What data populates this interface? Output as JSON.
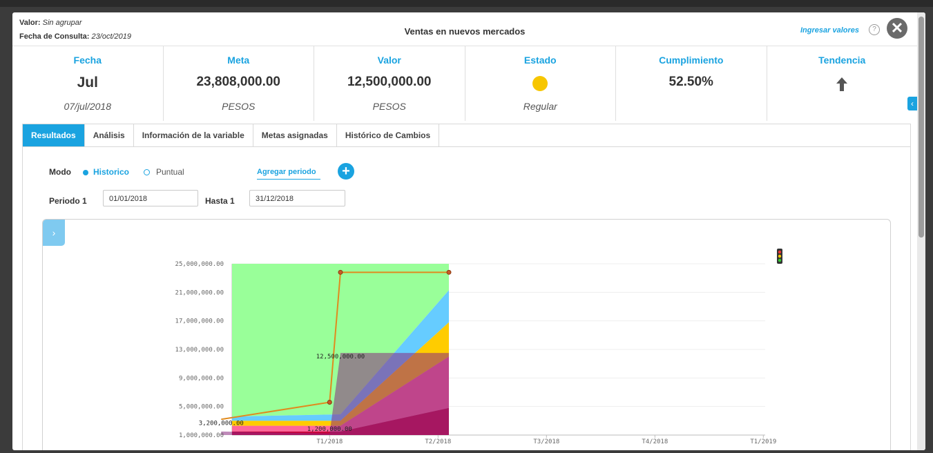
{
  "header": {
    "valor_label": "Valor:",
    "valor_value": "Sin agrupar",
    "fecha_label": "Fecha de Consulta:",
    "fecha_value": "23/oct/2019",
    "title": "Ventas en nuevos mercados",
    "ingresar": "Ingresar valores",
    "help": "?",
    "close": "✕"
  },
  "summary": [
    {
      "head": "Fecha",
      "value": "Jul",
      "sub": "07/jul/2018"
    },
    {
      "head": "Meta",
      "value": "23,808,000.00",
      "sub": "PESOS"
    },
    {
      "head": "Valor",
      "value": "12,500,000.00",
      "sub": "PESOS"
    },
    {
      "head": "Estado",
      "value": "",
      "sub": "Regular"
    },
    {
      "head": "Cumplimiento",
      "value": "52.50%",
      "sub": ""
    },
    {
      "head": "Tendencia",
      "value": "",
      "sub": ""
    }
  ],
  "status_color": "#f7c600",
  "tendencia_icon": "arrow-up-icon",
  "tabs": [
    "Resultados",
    "Análisis",
    "Información de la variable",
    "Metas asignadas",
    "Histórico de Cambios"
  ],
  "controls": {
    "modo": "Modo",
    "historico": "Historico",
    "puntual": "Puntual",
    "agregar": "Agregar periodo",
    "periodo_label": "Periodo 1",
    "periodo_value": "01/01/2018",
    "hasta_label": "Hasta 1",
    "hasta_value": "31/12/2018"
  },
  "chart_data": {
    "type": "area",
    "y_ticks": [
      "25,000,000.00",
      "21,000,000.00",
      "17,000,000.00",
      "13,000,000.00",
      "9,000,000.00",
      "5,000,000.00",
      "1,000,000.00"
    ],
    "x_ticks": [
      "T1/2018",
      "T2/2018",
      "T3/2018",
      "T4/2018",
      "T1/2019"
    ],
    "ylim": [
      1000000,
      25000000
    ],
    "x_positions": [
      0,
      1,
      2
    ],
    "band_tops": [
      {
        "color": "#c8003c",
        "values": [
          1500000,
          1500000,
          4800000
        ]
      },
      {
        "color": "#ff6699",
        "values": [
          2300000,
          2300000,
          12000000
        ]
      },
      {
        "color": "#ffcc00",
        "values": [
          3000000,
          3000000,
          16800000
        ]
      },
      {
        "color": "#66ccff",
        "values": [
          3600000,
          3900000,
          21300000
        ]
      },
      {
        "color": "#99ff99",
        "values": [
          25000000,
          25000000,
          25000000
        ]
      }
    ],
    "series": [
      {
        "name": "Valor",
        "x": [
          -0.1,
          0.9,
          1.0,
          2.0
        ],
        "values": [
          1500000,
          1200000,
          12500000,
          12500000
        ],
        "color": "#8b2a80"
      },
      {
        "name": "Meta",
        "x": [
          -0.1,
          0.9,
          1.0,
          2.0
        ],
        "values": [
          3200000,
          5600000,
          23808000,
          23808000
        ],
        "color": "#e08a1e"
      }
    ],
    "data_labels": [
      "3,200,000.00",
      "1,200,000.00",
      "12,500,000.00"
    ],
    "grid": true
  }
}
